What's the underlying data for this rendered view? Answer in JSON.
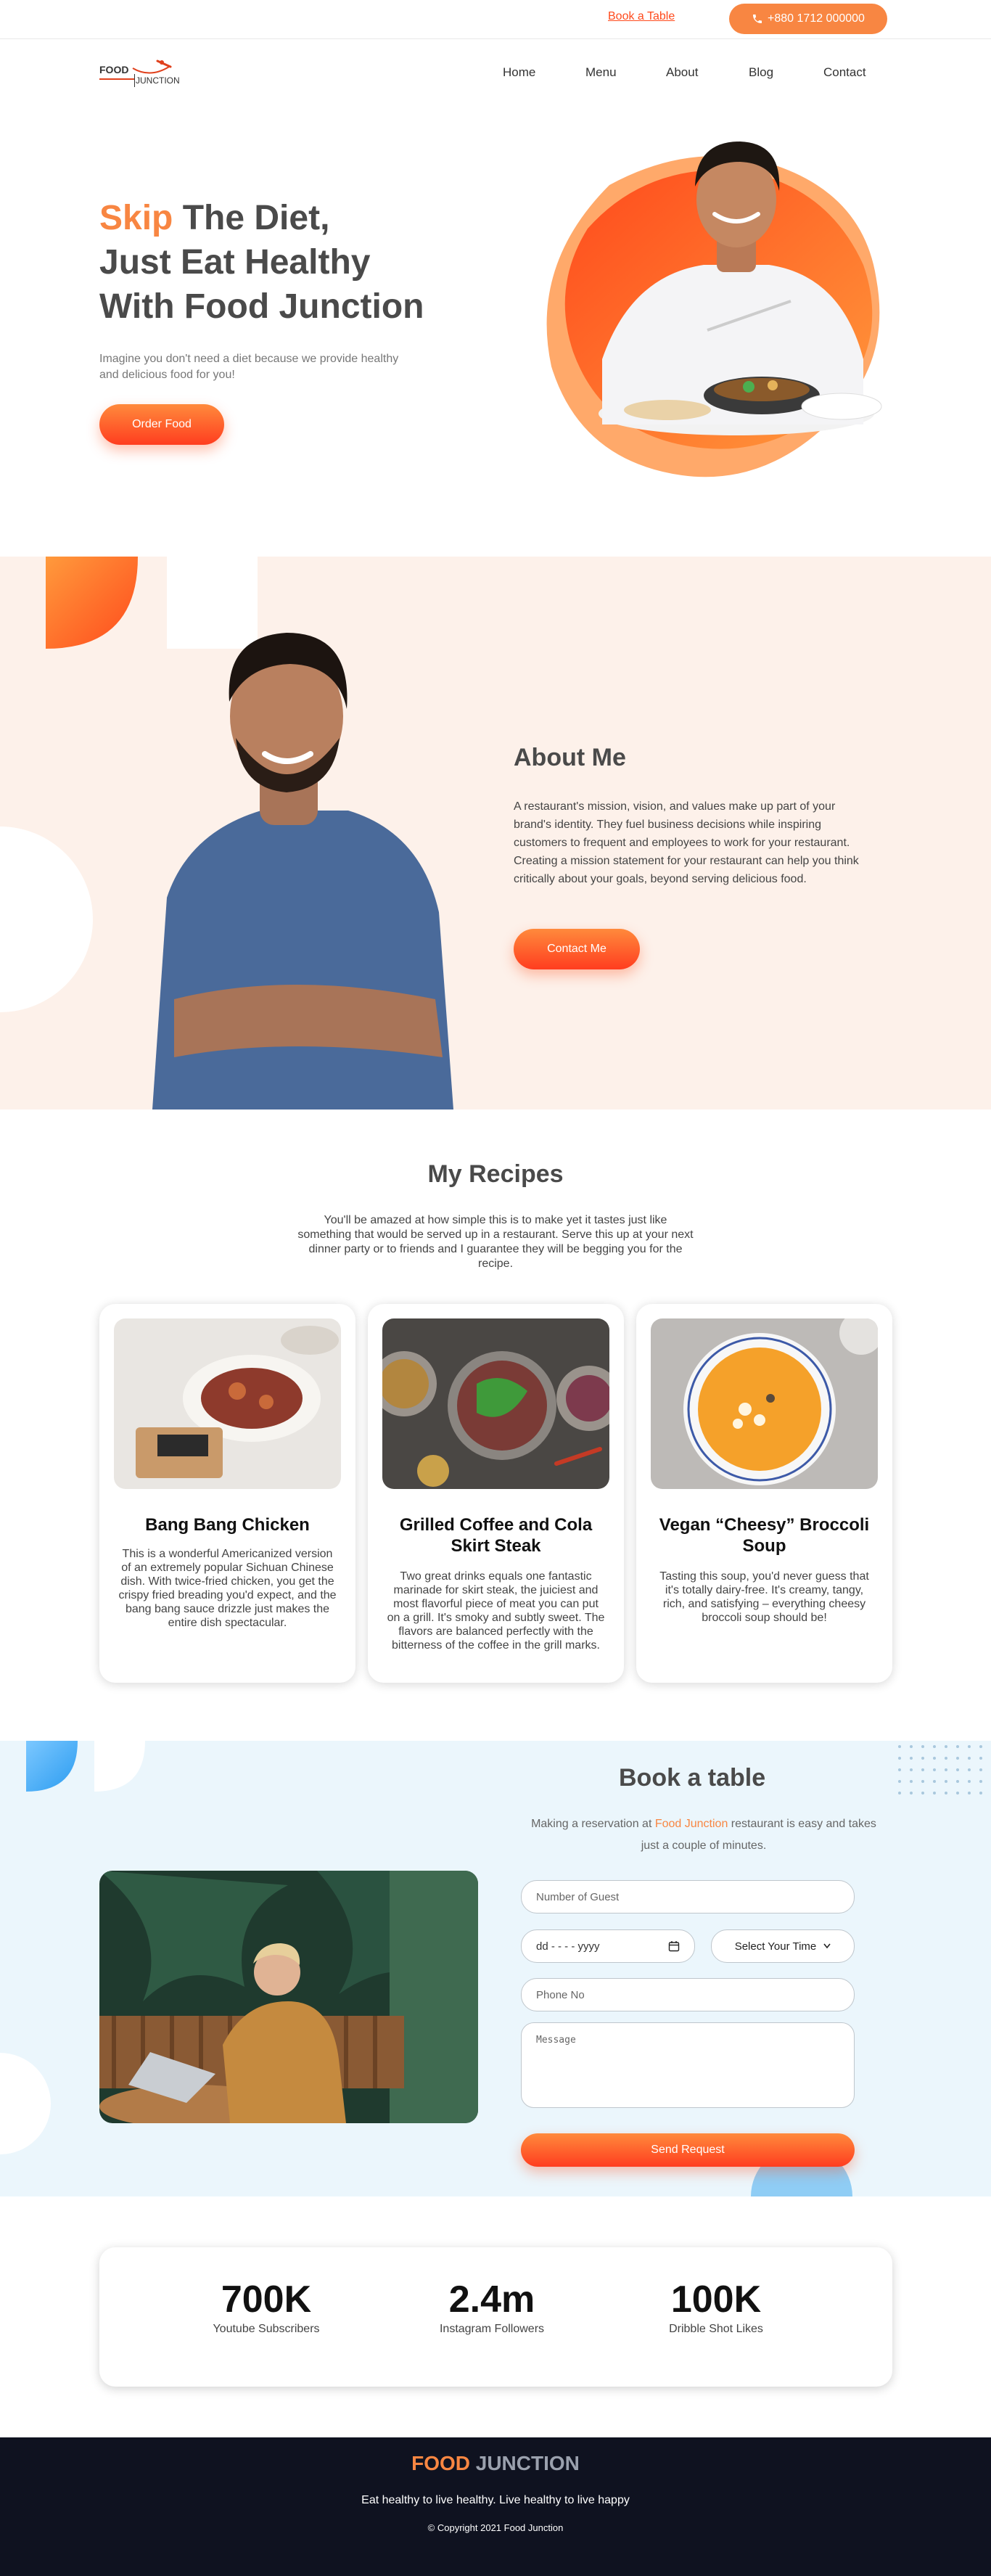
{
  "topbar": {
    "book_link": "Book a Table",
    "phone": "+880 1712 000000"
  },
  "logo": {
    "word1": "FOOD",
    "word2": "JUNCTION"
  },
  "nav": {
    "items": [
      "Home",
      "Menu",
      "About",
      "Blog",
      "Contact"
    ]
  },
  "hero": {
    "title_accent": "Skip",
    "title_line1_rest": " The Diet,",
    "title_line2": "Just Eat Healthy",
    "title_line3": "With Food Junction",
    "subtitle": "Imagine you don't need a diet because we provide healthy and delicious food for you!",
    "cta": "Order Food"
  },
  "about": {
    "heading": "About Me",
    "body": "A restaurant's mission, vision, and values make up part of your brand's identity. They fuel business decisions while inspiring customers to frequent and employees to work for your restaurant. Creating a mission statement for your restaurant can help you think critically about your goals, beyond serving delicious food.",
    "cta": "Contact Me"
  },
  "recipes": {
    "heading": "My Recipes",
    "intro": "You'll be amazed at how simple this is to make yet it tastes just like something that would be served up in a restaurant. Serve this up at your next dinner party or to friends and I guarantee they will be begging you for the recipe.",
    "cards": [
      {
        "title": "Bang Bang Chicken",
        "desc": "This is a wonderful Americanized version of an extremely popular Sichuan Chinese dish. With twice-fried chicken, you get the crispy fried breading you'd expect, and the bang bang sauce drizzle just makes the entire dish spectacular."
      },
      {
        "title": "Grilled Coffee and Cola Skirt Steak",
        "desc": "Two great drinks equals one fantastic marinade for skirt steak, the juiciest and most flavorful piece of meat you can put on a grill. It's smoky and subtly sweet. The flavors are balanced perfectly with the bitterness of the coffee in the grill marks."
      },
      {
        "title": "Vegan “Cheesy” Broccoli Soup",
        "desc": "Tasting this soup, you'd never guess that it's totally dairy-free. It's creamy, tangy, rich, and satisfying – everything cheesy broccoli soup should be!"
      }
    ]
  },
  "booking": {
    "heading": "Book a table",
    "intro_before": "Making a reservation at ",
    "intro_highlight": "Food Junction",
    "intro_after": " restaurant is easy and takes just a couple of minutes.",
    "guest_placeholder": "Number of Guest",
    "date_placeholder": "dd - - - - yyyy",
    "time_select": "Select Your Time",
    "phone_placeholder": "Phone No",
    "message_placeholder": "Message",
    "submit": "Send Request"
  },
  "stats": [
    {
      "value": "700K",
      "label": "Youtube Subscribers"
    },
    {
      "value": "2.4m",
      "label": "Instagram Followers"
    },
    {
      "value": "100K",
      "label": "Dribble Shot Likes"
    }
  ],
  "footer": {
    "brand_a": "FOOD",
    "brand_b": " JUNCTION",
    "tagline": "Eat healthy to live healthy. Live healthy to live happy",
    "copyright": "© Copyright 2021 Food Junction"
  },
  "colors": {
    "accent": "#f88642",
    "accent_red": "#ff3d1f",
    "about_bg": "#fdf1ea",
    "booking_bg": "#ebf6fc",
    "footer_bg": "#0f1220"
  }
}
